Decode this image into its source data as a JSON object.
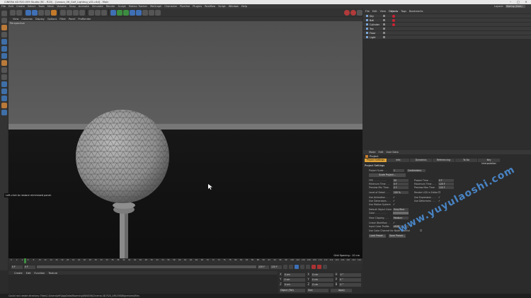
{
  "window": {
    "title": "CINEMA 4D R20.059 Studio (RC - R20) - [Lesson_06_Golf_Lighting_v01.c4d] - Main"
  },
  "menubar": {
    "items": [
      "File",
      "Edit",
      "Create",
      "Select",
      "Tools",
      "Mesh",
      "Volume",
      "Snap",
      "Animate",
      "Simulate",
      "Render",
      "Sculpt",
      "Motion Tracker",
      "MoGraph",
      "Character",
      "Pipeline",
      "Plugins",
      "Realflow",
      "Script",
      "Window",
      "Help"
    ],
    "layout_label": "Layout:",
    "layout_value": "Startup (User)"
  },
  "viewport": {
    "menu": [
      "View",
      "Cameras",
      "Display",
      "Options",
      "Filter",
      "Panel",
      "ProRender"
    ],
    "label": "Perspective",
    "grid_spacing": "Grid Spacing : 10 cm",
    "tooltip": "Left-click to restore minimized panel."
  },
  "timeline": {
    "ticks": [
      "0",
      "2",
      "4",
      "6",
      "8",
      "10",
      "12",
      "14",
      "16",
      "18",
      "20",
      "22",
      "24",
      "26",
      "28",
      "30",
      "32",
      "34",
      "36",
      "38",
      "40",
      "42",
      "44",
      "46",
      "48",
      "50",
      "52",
      "54",
      "56",
      "58",
      "60",
      "62",
      "64",
      "66",
      "68",
      "70",
      "72",
      "74",
      "76",
      "78",
      "80",
      "82",
      "84",
      "86",
      "88",
      "90",
      "92",
      "94",
      "96",
      "98",
      "100",
      "102",
      "104",
      "106",
      "108",
      "110",
      "112",
      "114",
      "116",
      "118",
      "120",
      "122",
      "124"
    ],
    "current_frame": "0 F",
    "start": "0 F",
    "end": "120 F",
    "end2": "120 F"
  },
  "material_manager": {
    "menu": [
      "Create",
      "Edit",
      "Function",
      "Texture"
    ]
  },
  "coords": {
    "rows": [
      {
        "a": "X",
        "av": "0 cm",
        "b": "X",
        "bv": "0 cm",
        "c": "H",
        "cv": "0 °"
      },
      {
        "a": "Y",
        "av": "0 cm",
        "b": "Y",
        "bv": "0 cm",
        "c": "P",
        "cv": "0 °"
      },
      {
        "a": "Z",
        "av": "0 cm",
        "b": "Z",
        "bv": "0 cm",
        "c": "B",
        "cv": "0 °"
      }
    ],
    "mode": "Object (Rel)",
    "size_mode": "Size",
    "apply": "Apply"
  },
  "status": {
    "text": "Could not create directory: Files\\C:\\Users\\Jeff\\AppData\\Roaming\\MAXON\\Cinema 4D R20_4FA19808\\preview\\files"
  },
  "object_manager": {
    "menu": [
      "File",
      "Edit",
      "View",
      "Objects",
      "Tags",
      "Bookmarks"
    ],
    "active": "Objects",
    "objects": [
      "Sky",
      "Ball",
      "Cylinder",
      "Tee",
      "Floor",
      "Light"
    ]
  },
  "attribute_manager": {
    "menu": [
      "Mode",
      "Edit",
      "User Data"
    ],
    "title": "Project",
    "tabs": [
      "Project Settings",
      "Info",
      "Dynamics",
      "Referencing",
      "To Do",
      "Key Interpolation"
    ],
    "section": "Project Settings",
    "fields": {
      "project_scale_label": "Project Scale . . .",
      "project_scale_value": "1",
      "project_scale_unit": "Centimeters",
      "scale_project_btn": "Scale Project...",
      "fps_label": "FPS . . . . . . . . .",
      "fps_value": "30",
      "project_time_label": "Project Time . . .",
      "project_time_value": "0 F",
      "min_time_label": "Minimum Time . . .",
      "min_time_value": "0 F",
      "max_time_label": "Maximum Time . . .",
      "max_time_value": "120 F",
      "prev_min_label": "Preview Min Time .",
      "prev_min_value": "0 F",
      "prev_max_label": "Preview Max Time .",
      "prev_max_value": "120 F",
      "lod_label": "Level of Detail . . .",
      "lod_value": "100 %",
      "render_lod_label": "Render LOD in Editor",
      "use_animation_label": "Use Animation . . .",
      "use_expression_label": "Use Expression . . .",
      "use_generators_label": "Use Generators . . .",
      "use_deformers_label": "Use Deformers . . .",
      "use_motion_label": "Use Motion System",
      "default_color_label": "Default Object Color",
      "default_color_value": "Gray Blue",
      "color_label": "Color . . . . . . . .",
      "view_clipping_label": "View Clipping . . .",
      "view_clipping_value": "Medium",
      "linear_workflow_label": "Linear Workflow . .",
      "input_color_label": "Input Color Profile .",
      "input_color_value": "sRGB",
      "color_channel_label": "Use Color Channel for Node Material",
      "load_preset_btn": "Load Preset...",
      "save_preset_btn": "Save Preset..."
    }
  },
  "watermark": "www.yuyulaoshi.com",
  "colors": {
    "accent": "#e0a43a",
    "active_blue": "#3d6fb5",
    "ball": "#9a9a9a"
  }
}
